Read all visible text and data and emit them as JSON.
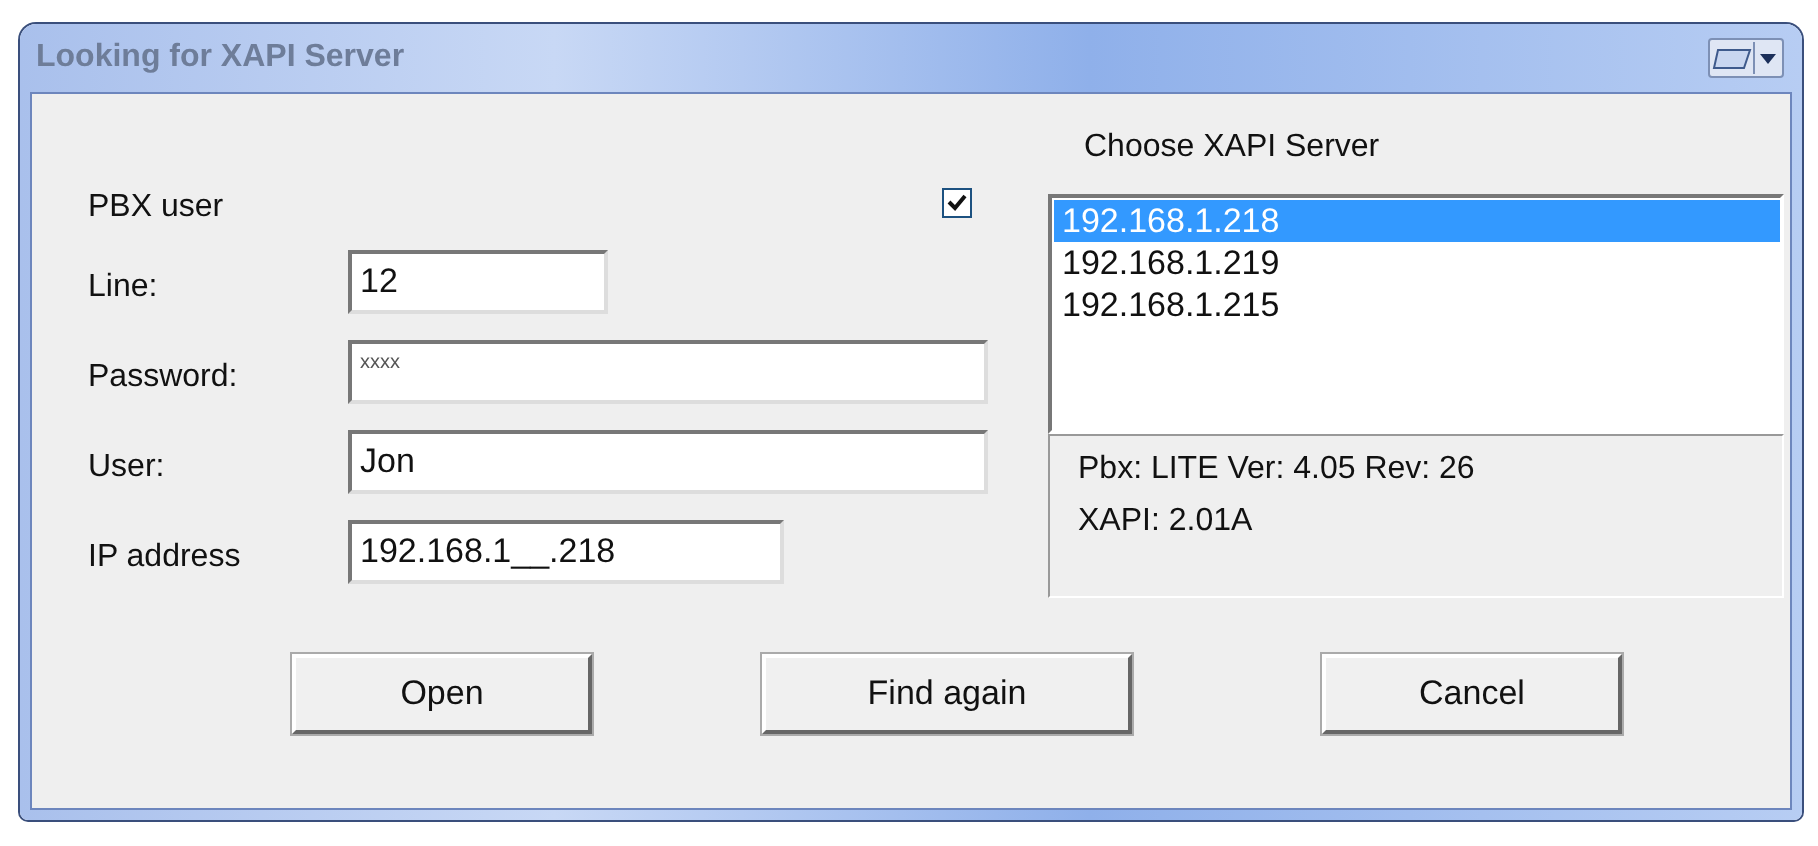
{
  "window": {
    "title": "Looking for XAPI Server"
  },
  "pbx_user": {
    "label": "PBX user",
    "checked": true
  },
  "fields": [
    {
      "kind": "short",
      "label": "Line:",
      "value": "12"
    },
    {
      "kind": "password",
      "label": "Password:",
      "value": "xxxx"
    },
    {
      "kind": "wide",
      "label": "User:",
      "value": "Jon"
    },
    {
      "kind": "medium",
      "label": "IP address",
      "value": "192.168.1__.218"
    }
  ],
  "server_list": {
    "heading": "Choose XAPI Server",
    "items": [
      {
        "label": "192.168.1.218",
        "selected": true
      },
      {
        "label": "192.168.1.219",
        "selected": false
      },
      {
        "label": "192.168.1.215",
        "selected": false
      }
    ]
  },
  "info": [
    "Pbx: LITE Ver: 4.05 Rev: 26",
    "XAPI: 2.01A"
  ],
  "buttons": [
    "Open",
    "Find again",
    "Cancel"
  ]
}
